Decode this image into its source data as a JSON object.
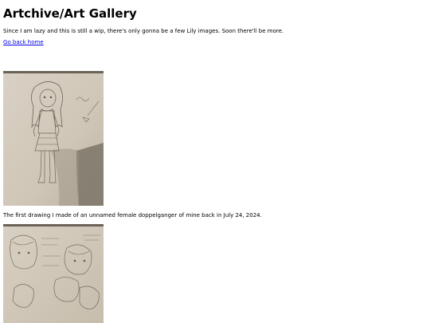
{
  "page": {
    "title": "Artchive/Art Gallery",
    "intro": "Since I am lazy and this is still a wip, there's only gonna be a few Lily images. Soon there'll be more.",
    "back_link": "Go back home"
  },
  "gallery": {
    "items": [
      {
        "image_icon": "pencil-sketch-chibi-girl",
        "caption": "The first drawing I made of an unnamed female doppelganger of mine back in July 24, 2024."
      },
      {
        "image_icon": "pencil-sketch-face-studies",
        "caption": ""
      }
    ]
  },
  "colors": {
    "link": "#0000ee",
    "text": "#000000",
    "background": "#ffffff"
  }
}
